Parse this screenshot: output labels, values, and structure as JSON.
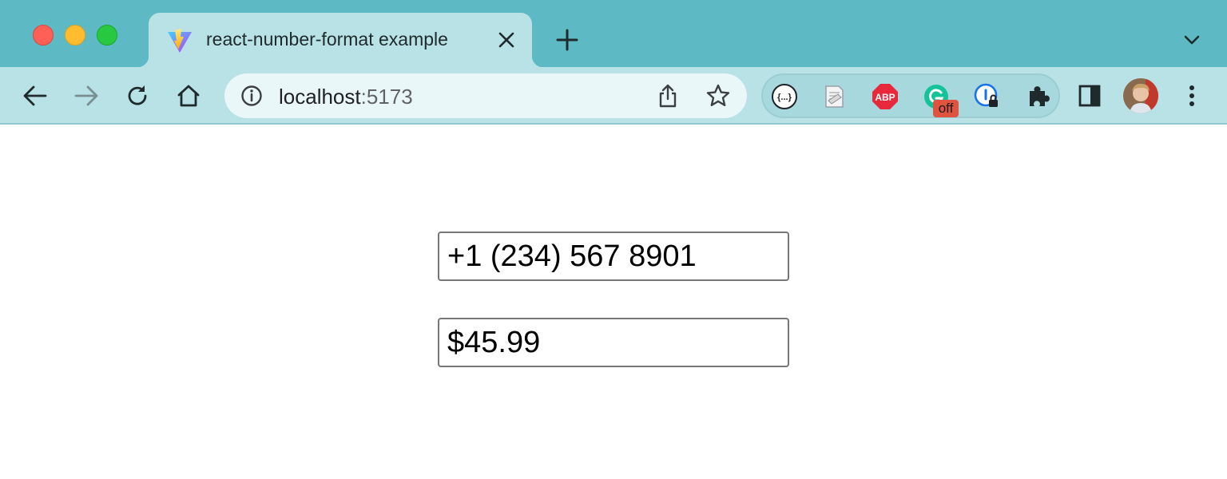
{
  "browser": {
    "tab": {
      "title": "react-number-format example",
      "favicon": "vite-icon"
    },
    "address": {
      "host": "localhost",
      "port": ":5173"
    },
    "extensions": [
      {
        "name": "json-formatter-icon"
      },
      {
        "name": "document-extension-icon"
      },
      {
        "name": "adblock-plus-icon",
        "label": "ABP"
      },
      {
        "name": "grammarly-icon",
        "badge": "off"
      },
      {
        "name": "password-manager-icon"
      },
      {
        "name": "extensions-puzzle-icon"
      }
    ],
    "colors": {
      "tabstrip": "#5db9c3",
      "toolbar": "#b8e2e6",
      "omnibox": "#eaf7f8"
    }
  },
  "page": {
    "phone_input": {
      "value": "+1 (234) 567 8901"
    },
    "price_input": {
      "value": "$45.99"
    }
  }
}
